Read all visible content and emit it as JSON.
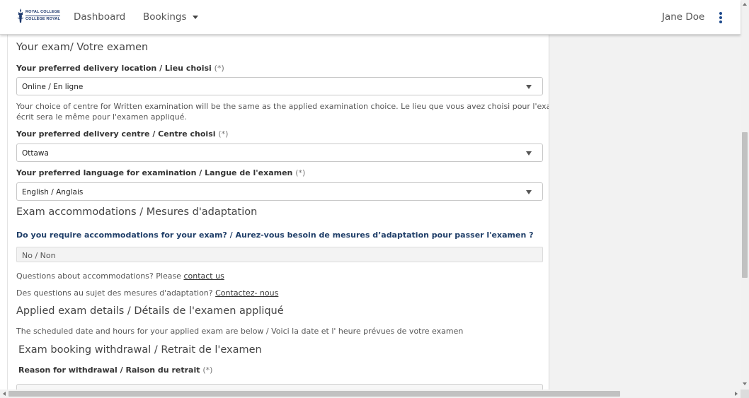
{
  "header": {
    "logo_line1": "ROYAL COLLEGE",
    "logo_line2": "COLLÈGE ROYAL",
    "nav_dashboard": "Dashboard",
    "nav_bookings": "Bookings",
    "user_name": "Jane Doe"
  },
  "exam": {
    "title": "Your exam/ Votre examen",
    "location_label": "Your preferred delivery location / Lieu choisi",
    "location_req": "(*)",
    "location_value": "Online / En ligne",
    "location_help_line1": "Your choice of centre for Written examination will be the same as the applied examination choice. Le lieu que vous avez choisi pour l'examen",
    "location_help_line2": "écrit sera le même pour l'examen appliqué.",
    "centre_label": "Your preferred delivery centre / Centre choisi",
    "centre_req": "(*)",
    "centre_value": "Ottawa",
    "language_label": "Your preferred language for examination / Langue de l'examen",
    "language_req": "(*)",
    "language_value": "English / Anglais"
  },
  "accommodations": {
    "title": "Exam accommodations / Mesures d'adaptation",
    "question": "Do you require accommodations for your exam? / Aurez-vous besoin de mesures d’adaptation pour passer l'examen ?",
    "answer": "No / Non",
    "q_en_prefix": "Questions about accommodations? Please ",
    "q_en_link": "contact us",
    "q_fr_prefix": "Des questions au sujet des mesures d'adaptation? ",
    "q_fr_link": "Contactez- nous"
  },
  "applied": {
    "title": "Applied exam details / Détails de l'examen appliqué",
    "text": "The scheduled date and hours for your applied exam are below / Voici la date et l' heure prévues de votre examen"
  },
  "withdrawal": {
    "title": "Exam booking withdrawal / Retrait de l'examen",
    "reason_label": "Reason for withdrawal / Raison du retrait",
    "reason_req": "(*)"
  },
  "colors": {
    "brand": "#1e3a6e",
    "question_text": "#1f3e68",
    "sidebar_bg": "#f2f2f2"
  }
}
